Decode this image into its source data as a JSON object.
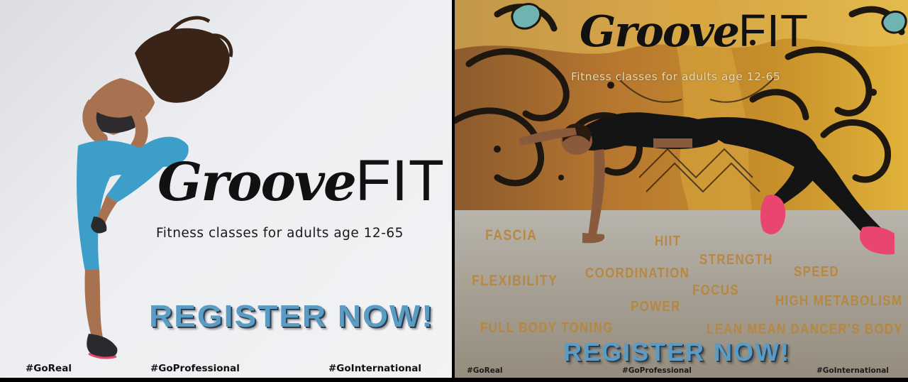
{
  "left_panel": {
    "logo": {
      "script": "Groove",
      "caps": "FIT"
    },
    "tagline": "Fitness classes for adults age 12-65",
    "cta": "REGISTER NOW!",
    "hashtags": [
      "#GoReal",
      "#GoProfessional",
      "#GoInternational"
    ]
  },
  "right_panel": {
    "logo": {
      "script": "Groove",
      "caps": "FIT"
    },
    "tagline": "Fitness classes for adults age 12-65",
    "benefits": [
      "FASCIA",
      "HIIT",
      "STRENGTH",
      "SPEED",
      "FLEXIBILITY",
      "COORDINATION",
      "FOCUS",
      "HIGH METABOLISM",
      "POWER",
      "FULL BODY TONING",
      "LEAN MEAN DANCER'S BODY"
    ],
    "cta": "REGISTER NOW!",
    "hashtags": [
      "#GoReal",
      "#GoProfessional",
      "#GoInternational"
    ]
  },
  "colors": {
    "cta_blue": "#5b9cc4",
    "benefit_gold": "#b8863a",
    "legging_teal": "#3d9fc9",
    "shoe_pink": "#e8466e"
  }
}
